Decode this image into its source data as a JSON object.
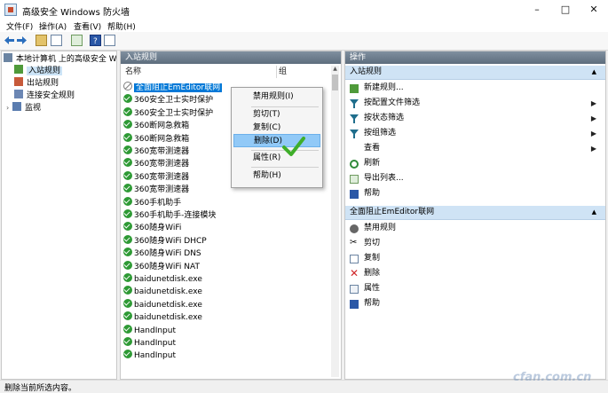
{
  "window": {
    "title": "高级安全 Windows 防火墙"
  },
  "menu": [
    "文件(F)",
    "操作(A)",
    "查看(V)",
    "帮助(H)"
  ],
  "tree": {
    "root": "本地计算机 上的高级安全 Wind",
    "items": [
      "入站规则",
      "出站规则",
      "连接安全规则",
      "监视"
    ]
  },
  "rules_pane": {
    "header": "入站规则",
    "columns": [
      "名称",
      "组"
    ],
    "rules": [
      "全面阻止EmEditor联网",
      "360安全卫士实时保护",
      "360安全卫士实时保护",
      "360断网急救箱",
      "360断网急救箱",
      "360宽带测速器",
      "360宽带测速器",
      "360宽带测速器",
      "360宽带测速器",
      "360手机助手",
      "360手机助手-连接模块",
      "360随身WiFi",
      "360随身WiFi DHCP",
      "360随身WiFi DNS",
      "360随身WiFi NAT",
      "baidunetdisk.exe",
      "baidunetdisk.exe",
      "baidunetdisk.exe",
      "baidunetdisk.exe",
      "HandInput",
      "HandInput",
      "HandInput"
    ]
  },
  "context_menu": {
    "items": [
      {
        "label": "禁用规则(I)"
      },
      {
        "label": "剪切(T)"
      },
      {
        "label": "复制(C)"
      },
      {
        "label": "删除(D)"
      },
      {
        "label": "属性(R)"
      },
      {
        "label": "帮助(H)"
      }
    ]
  },
  "actions_pane": {
    "header": "操作",
    "section1": {
      "title": "入站规则",
      "items": [
        "新建规则...",
        "按配置文件筛选",
        "按状态筛选",
        "按组筛选",
        "查看",
        "刷新",
        "导出列表...",
        "帮助"
      ]
    },
    "section2": {
      "title": "全面阻止EmEditor联网",
      "items": [
        "禁用规则",
        "剪切",
        "复制",
        "删除",
        "属性",
        "帮助"
      ]
    }
  },
  "status": {
    "text": "删除当前所选内容。"
  },
  "watermark": "cfan.com.cn"
}
